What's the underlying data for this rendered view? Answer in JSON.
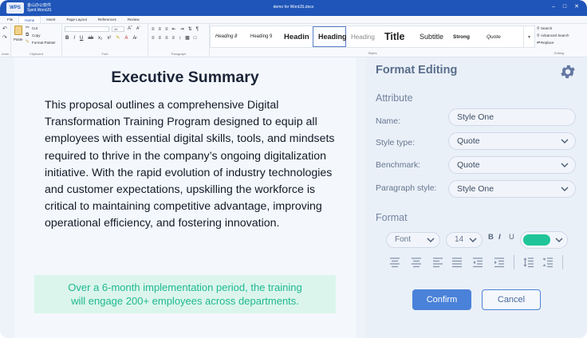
{
  "window": {
    "brand_icon_text": "WPS",
    "brand_line1": "金山办公软件",
    "brand_line2": "Spirit.WordJS",
    "title": "demo for WordJS.docx"
  },
  "menu_tabs": [
    "File",
    "Home",
    "Insert",
    "Page Layout",
    "References",
    "Review"
  ],
  "ribbon": {
    "clipboard": {
      "paste": "Paste",
      "cut": "Cut",
      "copy": "Copy",
      "format_painter": "Format Painter",
      "label": "Clipboard"
    },
    "undo_label": "Undo",
    "font": {
      "size": "10",
      "label": "Font"
    },
    "paragraph_label": "Paragraph",
    "styles": {
      "label": "Styles",
      "items": [
        "Heading 8",
        "Heading 9",
        "Headin",
        "Heading",
        "Heading",
        "Title",
        "Subtitle",
        "Strong",
        "Quote"
      ]
    },
    "editing": {
      "search": "Search",
      "advanced_search": "Advanced Search",
      "replace": "Replace",
      "label": "Editing"
    }
  },
  "document": {
    "title": "Executive Summary",
    "body": "This proposal outlines a comprehensive Digital Transformation Training Program designed to equip all employees with essential digital skills, tools, and mindsets required to thrive in the company’s ongoing digitalization initiative. With the rapid evolution of industry technologies and customer expectations, upskilling the workforce is critical to maintaining competitive advantage, improving operational efficiency, and fostering innovation.",
    "highlight_line1": "Over a 6-month implementation period, the training",
    "highlight_line2": "will engage 200+ employees across departments."
  },
  "panel": {
    "title": "Format Editing",
    "attribute_heading": "Attribute",
    "fields": [
      {
        "label": "Name:",
        "value": "Style One"
      },
      {
        "label": "Style type:",
        "value": "Quote"
      },
      {
        "label": "Benchmark:",
        "value": "Quote"
      },
      {
        "label": "Paragraph style:",
        "value": "Style One"
      }
    ],
    "format_heading": "Format",
    "font_select": "Font",
    "size_select": "14",
    "bold": "B",
    "italic": "I",
    "underline": "U",
    "font_color": "#1fc598",
    "confirm": "Confirm",
    "cancel": "Cancel"
  }
}
